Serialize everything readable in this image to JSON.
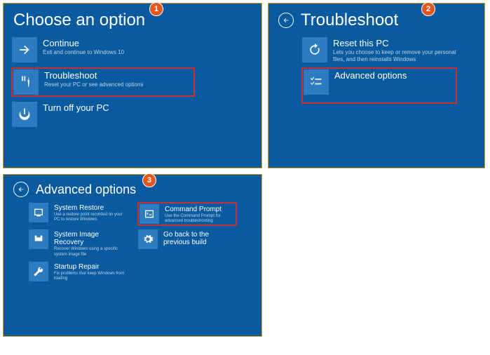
{
  "badges": {
    "one": "1",
    "two": "2",
    "three": "3"
  },
  "panel1": {
    "title": "Choose an option",
    "tiles": {
      "continue": {
        "title": "Continue",
        "sub": "Exit and continue to Windows 10"
      },
      "troubleshoot": {
        "title": "Troubleshoot",
        "sub": "Reset your PC or see advanced options"
      },
      "power": {
        "title": "Turn off your PC",
        "sub": ""
      }
    }
  },
  "panel2": {
    "title": "Troubleshoot",
    "tiles": {
      "reset": {
        "title": "Reset this PC",
        "sub": "Lets you choose to keep or remove your personal files, and then reinstalls Windows"
      },
      "advanced": {
        "title": "Advanced options",
        "sub": ""
      }
    }
  },
  "panel3": {
    "title": "Advanced options",
    "tiles": {
      "restore": {
        "title": "System Restore",
        "sub": "Use a restore point recorded on your PC to restore Windows"
      },
      "cmd": {
        "title": "Command Prompt",
        "sub": "Use the Command Prompt for advanced troubleshooting"
      },
      "image": {
        "title": "System Image Recovery",
        "sub": "Recover Windows using a specific system image file"
      },
      "goback": {
        "title": "Go back to the previous build",
        "sub": ""
      },
      "startup": {
        "title": "Startup Repair",
        "sub": "Fix problems that keep Windows from loading"
      }
    }
  }
}
